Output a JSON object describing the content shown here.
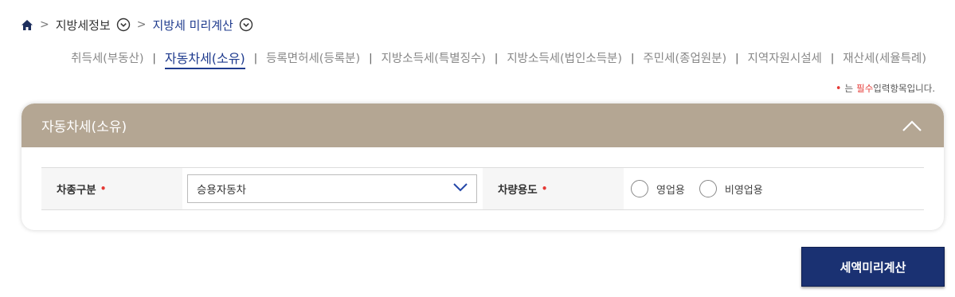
{
  "breadcrumb": {
    "home_icon": "home-icon",
    "level1": "지방세정보",
    "level2": "지방세 미리계산",
    "toggle_icon": "chevron-down-circle-icon"
  },
  "tabs": [
    {
      "label": "취득세(부동산)",
      "active": false
    },
    {
      "label": "자동차세(소유)",
      "active": true
    },
    {
      "label": "등록면허세(등록분)",
      "active": false
    },
    {
      "label": "지방소득세(특별징수)",
      "active": false
    },
    {
      "label": "지방소득세(법인소득분)",
      "active": false
    },
    {
      "label": "주민세(종업원분)",
      "active": false
    },
    {
      "label": "지역자원시설세",
      "active": false
    },
    {
      "label": "재산세(세율특례)",
      "active": false
    }
  ],
  "required_note": {
    "dot": "•",
    "prefix": "는",
    "required_word": "필수",
    "suffix": "입력항목입니다."
  },
  "panel": {
    "title": "자동차세(소유)",
    "collapse_icon": "chevron-up-icon"
  },
  "form": {
    "vehicle_type_label": "차종구분",
    "vehicle_type_value": "승용자동차",
    "required_mark": "•",
    "vehicle_use_label": "차량용도",
    "radio_options": [
      "영업용",
      "비영업용"
    ]
  },
  "action": {
    "calculate_label": "세액미리계산"
  },
  "colors": {
    "panel_header": "#b4a693",
    "primary_button": "#1a3172",
    "active_tab": "#1f3b8e",
    "required": "#e53935"
  }
}
